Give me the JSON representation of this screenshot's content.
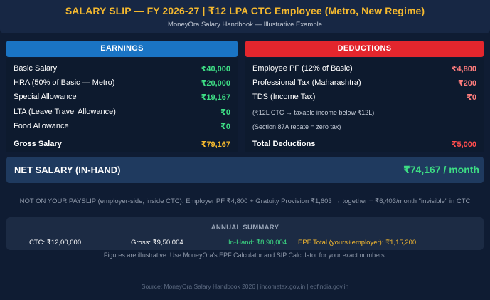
{
  "header": {
    "title": "SALARY SLIP — FY 2026-27 | ₹12 LPA CTC Employee (Metro, New Regime)",
    "subtitle": "MoneyOra Salary Handbook — Illustrative Example"
  },
  "earnings": {
    "heading": "EARNINGS",
    "items": [
      {
        "label": "Basic Salary",
        "value": "₹40,000"
      },
      {
        "label": "HRA (50% of Basic — Metro)",
        "value": "₹20,000"
      },
      {
        "label": "Special Allowance",
        "value": "₹19,167"
      },
      {
        "label": "LTA (Leave Travel Allowance)",
        "value": "₹0"
      },
      {
        "label": "Food Allowance",
        "value": "₹0"
      }
    ],
    "total_label": "Gross Salary",
    "total_value": "₹79,167"
  },
  "deductions": {
    "heading": "DEDUCTIONS",
    "items": [
      {
        "label": "Employee PF (12% of Basic)",
        "value": "₹4,800"
      },
      {
        "label": "Professional Tax (Maharashtra)",
        "value": "₹200"
      },
      {
        "label": "TDS (Income Tax)",
        "value": "₹0"
      }
    ],
    "notes": [
      "(₹12L CTC → taxable income below ₹12L)",
      "(Section 87A rebate = zero tax)"
    ],
    "total_label": "Total Deductions",
    "total_value": "₹5,000"
  },
  "net": {
    "label": "NET SALARY (IN-HAND)",
    "value": "₹74,167 / month"
  },
  "hidden_note": "NOT ON YOUR PAYSLIP (employer-side, inside CTC): Employer PF ₹4,800 + Gratuity Provision ₹1,603 → together = ₹6,403/month \"invisible\" in CTC",
  "annual": {
    "title": "ANNUAL SUMMARY",
    "ctc": "CTC: ₹12,00,000",
    "gross": "Gross: ₹9,50,004",
    "inhand": "In-Hand: ₹8,90,004",
    "epf": "EPF Total (yours+employer): ₹1,15,200"
  },
  "disclaimer": "Figures are illustrative. Use MoneyOra's EPF Calculator and SIP Calculator for your exact numbers.",
  "source": "Source: MoneyOra Salary Handbook 2026 | incometax.gov.in | epfindia.gov.in",
  "colors": {
    "background": "#0f1c33",
    "title": "#f5b92f",
    "earnings_accent": "#1a74c4",
    "deductions_accent": "#e3262d",
    "positive": "#3ddc84",
    "negative": "#ff7d7d"
  }
}
